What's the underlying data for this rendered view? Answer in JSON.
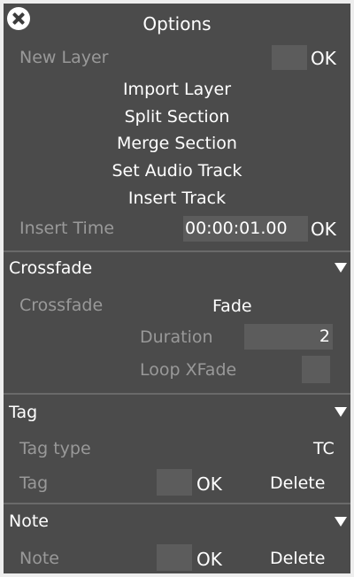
{
  "title": "Options",
  "top": {
    "new_layer_label": "New Layer",
    "new_layer_ok": "OK",
    "actions": [
      "Import Layer",
      "Split Section",
      "Merge Section",
      "Set Audio Track",
      "Insert Track"
    ],
    "insert_time_label": "Insert Time",
    "insert_time_value": "00:00:01.00",
    "insert_time_ok": "OK"
  },
  "crossfade": {
    "header": "Crossfade",
    "label": "Crossfade",
    "mode": "Fade",
    "duration_label": "Duration",
    "duration_value": "2",
    "loop_xfade_label": "Loop XFade"
  },
  "tag": {
    "header": "Tag",
    "type_label": "Tag type",
    "type_value": "TC",
    "tag_label": "Tag",
    "ok": "OK",
    "delete": "Delete"
  },
  "note": {
    "header": "Note",
    "note_label": "Note",
    "ok": "OK",
    "delete": "Delete"
  },
  "icons": {
    "close": "close-circle-icon",
    "collapse": "triangle-down-icon"
  },
  "colors": {
    "panel_bg": "#4b4b4b",
    "field_bg": "#5c5c5c",
    "dim_text": "#999999",
    "text": "#ffffff",
    "page_bg": "#eeeeee"
  }
}
